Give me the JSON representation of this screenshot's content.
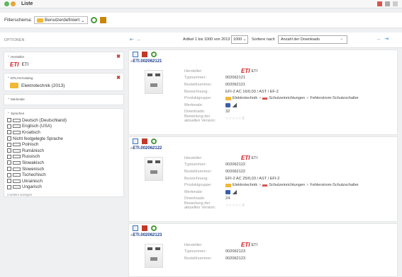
{
  "titlebar": {
    "title": "Liste"
  },
  "filterbar": {
    "label": "Filterschema:",
    "selected": "Benutzerdefiniert"
  },
  "header": {
    "options_label": "OPTIONEN",
    "article_info": "Artikel 1 bis 1000 von 2013",
    "page_size": "1000",
    "sort_label": "Sortiere nach",
    "sort_value": "Anzahl der Downloads"
  },
  "facets": {
    "manufacturer": {
      "title": "Hersteller",
      "value": "ETI",
      "logo": "ETI"
    },
    "catalog": {
      "title": "EPLAN-Katalog",
      "value": "Elektrotechnik (2013)"
    },
    "features": {
      "title": "Merkmale"
    },
    "languages": {
      "title": "Sprachen",
      "items": [
        {
          "label": "Deutsch (Deutschland)",
          "flag": "DE"
        },
        {
          "label": "Englisch (USA)",
          "flag": "US"
        },
        {
          "label": "Kroatisch",
          "flag": "HR"
        },
        {
          "label": "Nicht festgelegte Sprache",
          "flag": ""
        },
        {
          "label": "Polnisch",
          "flag": "PL"
        },
        {
          "label": "Rumänisch",
          "flag": "RO"
        },
        {
          "label": "Russisch",
          "flag": "RU"
        },
        {
          "label": "Slowakisch",
          "flag": "SK"
        },
        {
          "label": "Slowenisch",
          "flag": "SI"
        },
        {
          "label": "Tschechisch",
          "flag": "CZ"
        },
        {
          "label": "Ukrainisch",
          "flag": "UA"
        },
        {
          "label": "Ungarisch",
          "flag": "HU"
        }
      ],
      "more": "3 weitere anzeigen"
    }
  },
  "labels": {
    "manufacturer": "Hersteller:",
    "type_number": "Typnummer:",
    "order_number": "Bestellnummer:",
    "designation": "Bezeichnung:",
    "product_group": "Produktgruppe:",
    "features": "Merkmale:",
    "downloads": "Downloads:",
    "rating": "Bewertung der aktuellen Version:"
  },
  "products": [
    {
      "id": "ETI.002062121",
      "manufacturer_logo": "ETI",
      "manufacturer": "ETI",
      "type_number": "002062121",
      "order_number": "002062121",
      "designation": "EFI-2 AC 16/0,03 / AST / EF-2",
      "product_group": [
        "Elektrotechnik",
        "Schutzeinrichtungen",
        "Fehlerstrom-Schutzschalter"
      ],
      "downloads": "32",
      "rating": "☆☆☆☆☆ 0"
    },
    {
      "id": "ETI.002062122",
      "manufacturer_logo": "ETI",
      "manufacturer": "ETI",
      "type_number": "002062122",
      "order_number": "002062122",
      "designation": "EFI-2 AC 25/0,03 / AST / EFI-2",
      "product_group": [
        "Elektrotechnik",
        "Schutzeinrichtungen",
        "Fehlerstrom-Schutzschalter"
      ],
      "downloads": "24",
      "rating": "☆☆☆☆☆ 0"
    },
    {
      "id": "ETI.002062123",
      "manufacturer_logo": "ETI",
      "manufacturer": "ETI",
      "type_number": "002062123",
      "order_number": "002062123"
    }
  ]
}
